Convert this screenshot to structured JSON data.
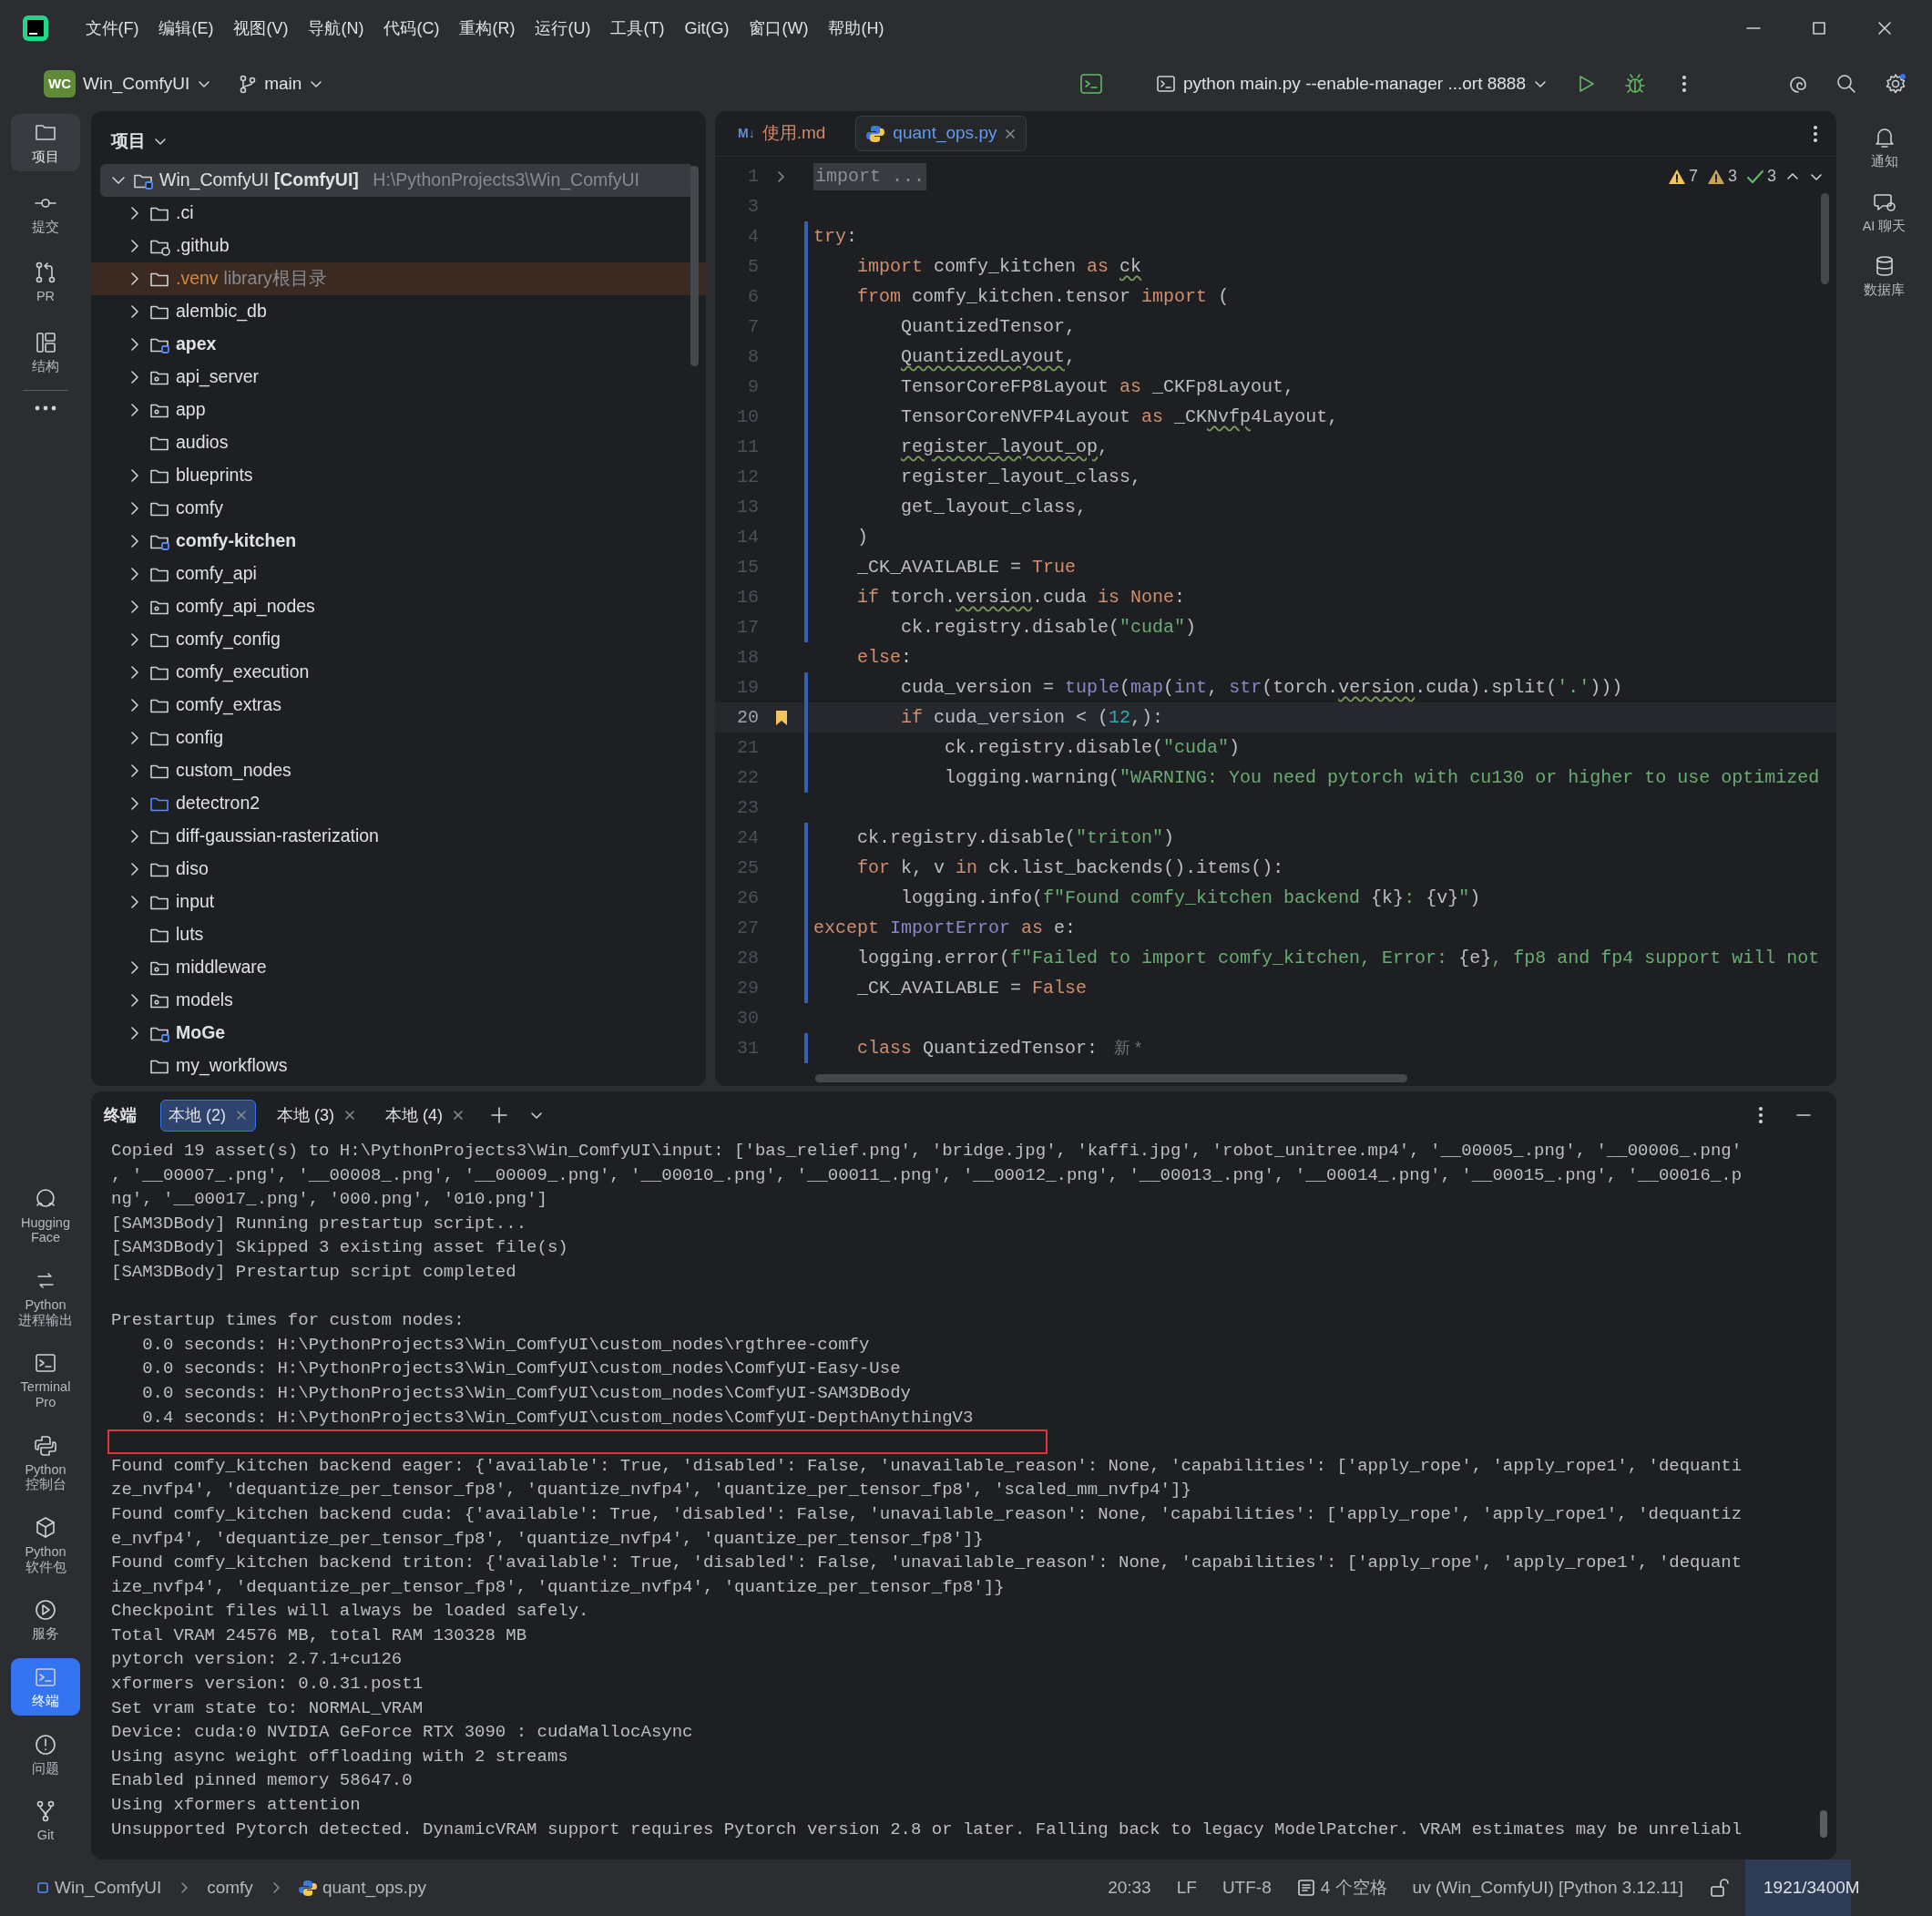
{
  "title_bar": {
    "menus": [
      "文件(F)",
      "编辑(E)",
      "视图(V)",
      "导航(N)",
      "代码(C)",
      "重构(R)",
      "运行(U)",
      "工具(T)",
      "Git(G)",
      "窗口(W)",
      "帮助(H)"
    ]
  },
  "toolbar": {
    "project_badge": "WC",
    "project": "Win_ComfyUI",
    "branch": "main",
    "run_config": "python main.py --enable-manager ...ort 8888"
  },
  "activity_bar": {
    "top": [
      {
        "label": "项目",
        "selected": true
      },
      {
        "label": "提交",
        "selected": false
      },
      {
        "label": "PR",
        "selected": false
      },
      {
        "label": "结构",
        "selected": false
      }
    ],
    "bottom": [
      {
        "label": "Hugging Face",
        "selected": false
      },
      {
        "label": "Python 进程输出",
        "selected": false
      },
      {
        "label": "Terminal Pro",
        "selected": false
      },
      {
        "label": "Python 控制台",
        "selected": false
      },
      {
        "label": "Python 软件包",
        "selected": false
      },
      {
        "label": "服务",
        "selected": false
      },
      {
        "label": "终端",
        "selected": true
      },
      {
        "label": "问题",
        "selected": false
      },
      {
        "label": "Git",
        "selected": false
      }
    ]
  },
  "project_panel": {
    "title": "项目",
    "root": {
      "name": "Win_ComfyUI",
      "module": "[ComfyUI]",
      "path": "H:\\PythonProjects3\\Win_ComfyUI",
      "expanded": true,
      "selected": true
    },
    "items": [
      {
        "name": ".ci",
        "kind": "folder",
        "expandable": true
      },
      {
        "name": ".github",
        "kind": "git",
        "expandable": true
      },
      {
        "name": ".venv",
        "kind": "excluded",
        "expandable": true,
        "hint": "library根目录"
      },
      {
        "name": "alembic_db",
        "kind": "folder",
        "expandable": true
      },
      {
        "name": "apex",
        "kind": "module",
        "expandable": true
      },
      {
        "name": "api_server",
        "kind": "package",
        "expandable": true
      },
      {
        "name": "app",
        "kind": "package",
        "expandable": true
      },
      {
        "name": "audios",
        "kind": "folder",
        "expandable": false
      },
      {
        "name": "blueprints",
        "kind": "folder",
        "expandable": true
      },
      {
        "name": "comfy",
        "kind": "folder",
        "expandable": true
      },
      {
        "name": "comfy-kitchen",
        "kind": "module",
        "expandable": true
      },
      {
        "name": "comfy_api",
        "kind": "folder",
        "expandable": true
      },
      {
        "name": "comfy_api_nodes",
        "kind": "package",
        "expandable": true
      },
      {
        "name": "comfy_config",
        "kind": "folder",
        "expandable": true
      },
      {
        "name": "comfy_execution",
        "kind": "folder",
        "expandable": true
      },
      {
        "name": "comfy_extras",
        "kind": "folder",
        "expandable": true
      },
      {
        "name": "config",
        "kind": "folder",
        "expandable": true
      },
      {
        "name": "custom_nodes",
        "kind": "folder",
        "expandable": true
      },
      {
        "name": "detectron2",
        "kind": "source",
        "expandable": true
      },
      {
        "name": "diff-gaussian-rasterization",
        "kind": "folder",
        "expandable": true
      },
      {
        "name": "diso",
        "kind": "folder",
        "expandable": true
      },
      {
        "name": "input",
        "kind": "folder",
        "expandable": true
      },
      {
        "name": "luts",
        "kind": "folder",
        "expandable": false
      },
      {
        "name": "middleware",
        "kind": "package",
        "expandable": true
      },
      {
        "name": "models",
        "kind": "package",
        "expandable": true
      },
      {
        "name": "MoGe",
        "kind": "module",
        "expandable": true
      },
      {
        "name": "my_workflows",
        "kind": "folder",
        "expandable": false
      }
    ]
  },
  "editor": {
    "tabs": [
      {
        "label": "使用.md",
        "badge": "M↓",
        "kind": "markdown",
        "selected": false
      },
      {
        "label": "quant_ops.py",
        "kind": "python",
        "selected": true
      }
    ],
    "inspections": {
      "warnings": "7",
      "weak_warnings": "3",
      "passed": "3"
    },
    "lines": [
      {
        "n": "1",
        "tokens": [
          {
            "kind": "f",
            "text": "import ..."
          }
        ],
        "changed": false,
        "current": false,
        "bookmark": false
      },
      {
        "n": "3",
        "changed": false,
        "current": false,
        "bookmark": false
      },
      {
        "n": "4",
        "tokens": [
          {
            "kind": "k",
            "text": "try"
          },
          {
            "kind": "p",
            "text": ":"
          }
        ],
        "changed": true,
        "current": false,
        "bookmark": false
      },
      {
        "n": "5",
        "tokens": [
          {
            "kind": "k",
            "text": "    import"
          },
          {
            "kind": "p",
            "text": " comfy_kitchen "
          },
          {
            "kind": "k",
            "text": "as "
          },
          {
            "kind": "w",
            "text": "ck"
          }
        ],
        "changed": true,
        "current": false,
        "bookmark": false
      },
      {
        "n": "6",
        "tokens": [
          {
            "kind": "k",
            "text": "    from"
          },
          {
            "kind": "p",
            "text": " comfy_kitchen.tensor "
          },
          {
            "kind": "k",
            "text": "import"
          },
          {
            "kind": "p",
            "text": " ("
          }
        ],
        "changed": true,
        "current": false,
        "bookmark": false
      },
      {
        "n": "7",
        "tokens": [
          {
            "kind": "p",
            "text": "        QuantizedTensor,"
          }
        ],
        "changed": true,
        "current": false,
        "bookmark": false
      },
      {
        "n": "8",
        "tokens": [
          {
            "kind": "w",
            "text": "        QuantizedLayout"
          },
          {
            "kind": "p",
            "text": ","
          }
        ],
        "changed": true,
        "current": false,
        "bookmark": false
      },
      {
        "n": "9",
        "tokens": [
          {
            "kind": "p",
            "text": "        TensorCoreFP8Layout "
          },
          {
            "kind": "k",
            "text": "as"
          },
          {
            "kind": "p",
            "text": " _CKFp8Layout,"
          }
        ],
        "changed": true,
        "current": false,
        "bookmark": false
      },
      {
        "n": "10",
        "tokens": [
          {
            "kind": "p",
            "text": "        TensorCoreNVFP4Layout "
          },
          {
            "kind": "k",
            "text": "as"
          },
          {
            "kind": "p",
            "text": " _CK"
          },
          {
            "kind": "w",
            "text": "Nvfp"
          },
          {
            "kind": "p",
            "text": "4Layout,"
          }
        ],
        "changed": true,
        "current": false,
        "bookmark": false
      },
      {
        "n": "11",
        "tokens": [
          {
            "kind": "w",
            "text": "        register_layout_op"
          },
          {
            "kind": "p",
            "text": ","
          }
        ],
        "changed": true,
        "current": false,
        "bookmark": false
      },
      {
        "n": "12",
        "tokens": [
          {
            "kind": "p",
            "text": "        register_layout_class,"
          }
        ],
        "changed": true,
        "current": false,
        "bookmark": false
      },
      {
        "n": "13",
        "tokens": [
          {
            "kind": "p",
            "text": "        get_layout_class,"
          }
        ],
        "changed": true,
        "current": false,
        "bookmark": false
      },
      {
        "n": "14",
        "tokens": [
          {
            "kind": "p",
            "text": "    )"
          }
        ],
        "changed": true,
        "current": false,
        "bookmark": false
      },
      {
        "n": "15",
        "tokens": [
          {
            "kind": "p",
            "text": "    _CK_AVAILABLE = "
          },
          {
            "kind": "k",
            "text": "True"
          }
        ],
        "changed": true,
        "current": false,
        "bookmark": false
      },
      {
        "n": "16",
        "tokens": [
          {
            "kind": "k",
            "text": "    if"
          },
          {
            "kind": "p",
            "text": " torch."
          },
          {
            "kind": "w",
            "text": "version"
          },
          {
            "kind": "p",
            "text": ".cuda "
          },
          {
            "kind": "k",
            "text": "is None"
          },
          {
            "kind": "p",
            "text": ":"
          }
        ],
        "changed": true,
        "current": false,
        "bookmark": false
      },
      {
        "n": "17",
        "tokens": [
          {
            "kind": "p",
            "text": "        ck.registry.disable("
          },
          {
            "kind": "s",
            "text": "\"cuda\""
          },
          {
            "kind": "p",
            "text": ")"
          }
        ],
        "changed": true,
        "current": false,
        "bookmark": false
      },
      {
        "n": "18",
        "tokens": [
          {
            "kind": "k",
            "text": "    else"
          },
          {
            "kind": "p",
            "text": ":"
          }
        ],
        "changed": false,
        "current": false,
        "bookmark": false
      },
      {
        "n": "19",
        "tokens": [
          {
            "kind": "p",
            "text": "        cuda_version = "
          },
          {
            "kind": "b",
            "text": "tuple"
          },
          {
            "kind": "p",
            "text": "("
          },
          {
            "kind": "b",
            "text": "map"
          },
          {
            "kind": "p",
            "text": "("
          },
          {
            "kind": "b",
            "text": "int"
          },
          {
            "kind": "p",
            "text": ", "
          },
          {
            "kind": "b",
            "text": "str"
          },
          {
            "kind": "p",
            "text": "(torch."
          },
          {
            "kind": "w",
            "text": "version"
          },
          {
            "kind": "p",
            "text": ".cuda).split("
          },
          {
            "kind": "s",
            "text": "'.'"
          },
          {
            "kind": "p",
            "text": ")))"
          }
        ],
        "changed": true,
        "current": false,
        "bookmark": false
      },
      {
        "n": "20",
        "tokens": [
          {
            "kind": "k",
            "text": "        if"
          },
          {
            "kind": "p",
            "text": " cuda_version < ("
          },
          {
            "kind": "n",
            "text": "12"
          },
          {
            "kind": "p",
            "text": ",):"
          }
        ],
        "changed": true,
        "current": true,
        "bookmark": true
      },
      {
        "n": "21",
        "tokens": [
          {
            "kind": "p",
            "text": "            ck.registry.disable("
          },
          {
            "kind": "s",
            "text": "\"cuda\""
          },
          {
            "kind": "p",
            "text": ")"
          }
        ],
        "changed": true,
        "current": false,
        "bookmark": false
      },
      {
        "n": "22",
        "tokens": [
          {
            "kind": "p",
            "text": "            logging.warning("
          },
          {
            "kind": "s",
            "text": "\"WARNING: You need pytorch with cu130 or higher to use optimized"
          }
        ],
        "changed": true,
        "current": false,
        "bookmark": false
      },
      {
        "n": "23",
        "changed": false,
        "current": false,
        "bookmark": false
      },
      {
        "n": "24",
        "tokens": [
          {
            "kind": "p",
            "text": "    ck.registry.disable("
          },
          {
            "kind": "s",
            "text": "\"triton\""
          },
          {
            "kind": "p",
            "text": ")"
          }
        ],
        "changed": true,
        "current": false,
        "bookmark": false
      },
      {
        "n": "25",
        "tokens": [
          {
            "kind": "k",
            "text": "    for"
          },
          {
            "kind": "p",
            "text": " k, v "
          },
          {
            "kind": "k",
            "text": "in"
          },
          {
            "kind": "p",
            "text": " ck.list_backends().items():"
          }
        ],
        "changed": true,
        "current": false,
        "bookmark": false
      },
      {
        "n": "26",
        "tokens": [
          {
            "kind": "p",
            "text": "        logging.info("
          },
          {
            "kind": "s",
            "text": "f\"Found comfy_kitchen backend "
          },
          {
            "kind": "p",
            "text": "{k}"
          },
          {
            "kind": "s",
            "text": ": "
          },
          {
            "kind": "p",
            "text": "{v}"
          },
          {
            "kind": "s",
            "text": "\""
          },
          {
            "kind": "p",
            "text": ")"
          }
        ],
        "changed": true,
        "current": false,
        "bookmark": false
      },
      {
        "n": "27",
        "tokens": [
          {
            "kind": "k",
            "text": "except "
          },
          {
            "kind": "b",
            "text": "ImportError"
          },
          {
            "kind": "k",
            "text": " as"
          },
          {
            "kind": "p",
            "text": " e:"
          }
        ],
        "changed": true,
        "current": false,
        "bookmark": false
      },
      {
        "n": "28",
        "tokens": [
          {
            "kind": "p",
            "text": "    logging.error("
          },
          {
            "kind": "s",
            "text": "f\"Failed to import comfy_kitchen, Error: "
          },
          {
            "kind": "p",
            "text": "{e}"
          },
          {
            "kind": "s",
            "text": ", fp8 and fp4 support will not"
          }
        ],
        "changed": true,
        "current": false,
        "bookmark": false
      },
      {
        "n": "29",
        "tokens": [
          {
            "kind": "p",
            "text": "    _CK_AVAILABLE = "
          },
          {
            "kind": "k",
            "text": "False"
          }
        ],
        "changed": true,
        "current": false,
        "bookmark": false
      },
      {
        "n": "30",
        "changed": false,
        "current": false,
        "bookmark": false
      },
      {
        "n": "31",
        "tokens": [
          {
            "kind": "k",
            "text": "    class"
          },
          {
            "kind": "p",
            "text": " QuantizedTensor:"
          },
          {
            "kind": "h",
            "text": "新 *"
          }
        ],
        "changed": true,
        "current": false,
        "bookmark": false
      }
    ]
  },
  "right_bar": [
    {
      "label": "通知"
    },
    {
      "label": "AI 聊天"
    },
    {
      "label": "数据库"
    }
  ],
  "terminal": {
    "title": "终端",
    "tabs": [
      {
        "label": "本地 (2)",
        "selected": true
      },
      {
        "label": "本地 (3)",
        "selected": false
      },
      {
        "label": "本地 (4)",
        "selected": false
      }
    ],
    "lines": [
      {
        "kind": "text",
        "text": "Copied 19 asset(s) to H:\\PythonProjects3\\Win_ComfyUI\\input: ['bas_relief.png', 'bridge.jpg', 'kaffi.jpg', 'robot_unitree.mp4', '__00005_.png', '__00006_.png'"
      },
      {
        "kind": "text",
        "text": ", '__00007_.png', '__00008_.png', '__00009_.png', '__00010_.png', '__00011_.png', '__00012_.png', '__00013_.png', '__00014_.png', '__00015_.png', '__00016_.p"
      },
      {
        "kind": "text",
        "text": "ng', '__00017_.png', '000.png', '010.png']"
      },
      {
        "kind": "text",
        "text": "[SAM3DBody] Running prestartup script..."
      },
      {
        "kind": "text",
        "text": "[SAM3DBody] Skipped 3 existing asset file(s)"
      },
      {
        "kind": "text",
        "text": "[SAM3DBody] Prestartup script completed"
      },
      {
        "kind": "blank",
        "highlighted": false
      },
      {
        "kind": "text",
        "text": "Prestartup times for custom nodes:"
      },
      {
        "kind": "text",
        "text": "   0.0 seconds: H:\\PythonProjects3\\Win_ComfyUI\\custom_nodes\\rgthree-comfy"
      },
      {
        "kind": "text",
        "text": "   0.0 seconds: H:\\PythonProjects3\\Win_ComfyUI\\custom_nodes\\ComfyUI-Easy-Use"
      },
      {
        "kind": "text",
        "text": "   0.0 seconds: H:\\PythonProjects3\\Win_ComfyUI\\custom_nodes\\ComfyUI-SAM3DBody"
      },
      {
        "kind": "text",
        "text": "   0.4 seconds: H:\\PythonProjects3\\Win_ComfyUI\\custom_nodes\\ComfyUI-DepthAnythingV3"
      },
      {
        "kind": "blank",
        "highlighted": true
      },
      {
        "kind": "text",
        "text": "Found comfy_kitchen backend eager: {'available': True, 'disabled': False, 'unavailable_reason': None, 'capabilities': ['apply_rope', 'apply_rope1', 'dequanti"
      },
      {
        "kind": "text",
        "text": "ze_nvfp4', 'dequantize_per_tensor_fp8', 'quantize_nvfp4', 'quantize_per_tensor_fp8', 'scaled_mm_nvfp4']}"
      },
      {
        "kind": "text",
        "text": "Found comfy_kitchen backend cuda: {'available': True, 'disabled': False, 'unavailable_reason': None, 'capabilities': ['apply_rope', 'apply_rope1', 'dequantiz"
      },
      {
        "kind": "text",
        "text": "e_nvfp4', 'dequantize_per_tensor_fp8', 'quantize_nvfp4', 'quantize_per_tensor_fp8']}"
      },
      {
        "kind": "text",
        "text": "Found comfy_kitchen backend triton: {'available': True, 'disabled': False, 'unavailable_reason': None, 'capabilities': ['apply_rope', 'apply_rope1', 'dequant"
      },
      {
        "kind": "text",
        "text": "ize_nvfp4', 'dequantize_per_tensor_fp8', 'quantize_nvfp4', 'quantize_per_tensor_fp8']}"
      },
      {
        "kind": "text",
        "text": "Checkpoint files will always be loaded safely."
      },
      {
        "kind": "text",
        "text": "Total VRAM 24576 MB, total RAM 130328 MB"
      },
      {
        "kind": "text",
        "text": "pytorch version: 2.7.1+cu126"
      },
      {
        "kind": "text",
        "text": "xformers version: 0.0.31.post1"
      },
      {
        "kind": "text",
        "text": "Set vram state to: NORMAL_VRAM"
      },
      {
        "kind": "text",
        "text": "Device: cuda:0 NVIDIA GeForce RTX 3090 : cudaMallocAsync"
      },
      {
        "kind": "text",
        "text": "Using async weight offloading with 2 streams"
      },
      {
        "kind": "text",
        "text": "Enabled pinned memory 58647.0"
      },
      {
        "kind": "text",
        "text": "Using xformers attention"
      },
      {
        "kind": "text",
        "text": "Unsupported Pytorch detected. DynamicVRAM support requires Pytorch version 2.8 or later. Falling back to legacy ModelPatcher. VRAM estimates may be unreliabl"
      }
    ]
  },
  "status_bar": {
    "breadcrumbs": [
      "Win_ComfyUI",
      "comfy",
      "quant_ops.py"
    ],
    "caret": "20:33",
    "line_separator": "LF",
    "encoding": "UTF-8",
    "indent": "4 个空格",
    "interpreter": "uv (Win_ComfyUI) [Python 3.12.11]",
    "memory": {
      "text": "1921/3400M",
      "level": 0.565
    }
  }
}
